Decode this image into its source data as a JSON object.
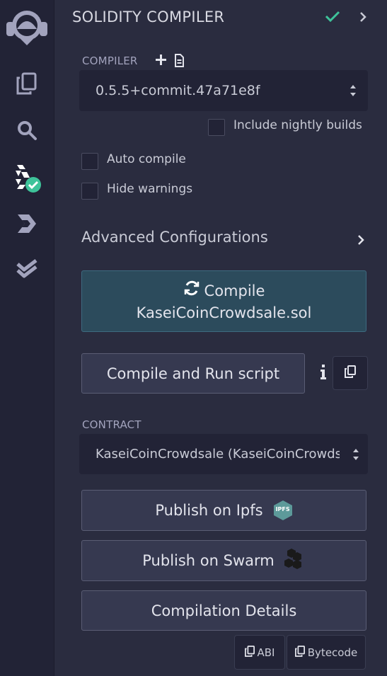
{
  "sidebar": {
    "icons": [
      "remix-logo-icon",
      "file-explorer-icon",
      "search-icon",
      "solidity-compiler-icon",
      "deploy-run-icon",
      "unit-testing-icon"
    ]
  },
  "header": {
    "title": "SOLIDITY COMPILER",
    "status_color": "#3ec39a"
  },
  "compiler": {
    "label": "COMPILER",
    "selected_version": "0.5.5+commit.47a71e8f",
    "include_nightly_label": "Include nightly builds",
    "include_nightly_checked": false
  },
  "options": {
    "auto_compile_label": "Auto compile",
    "auto_compile_checked": false,
    "hide_warnings_label": "Hide warnings",
    "hide_warnings_checked": false
  },
  "advanced": {
    "label": "Advanced Configurations"
  },
  "compile_button": {
    "line1": "Compile",
    "line2": "KaseiCoinCrowdsale.sol"
  },
  "run_script_button": {
    "label": "Compile and Run script"
  },
  "contract": {
    "label": "CONTRACT",
    "selected": "KaseiCoinCrowdsale (KaseiCoinCrowdsale.sol)"
  },
  "publish_ipfs": {
    "label": "Publish on Ipfs",
    "badge": "IPFS"
  },
  "publish_swarm": {
    "label": "Publish on Swarm"
  },
  "compilation_details": {
    "label": "Compilation Details"
  },
  "copy_buttons": {
    "abi": "ABI",
    "bytecode": "Bytecode"
  }
}
